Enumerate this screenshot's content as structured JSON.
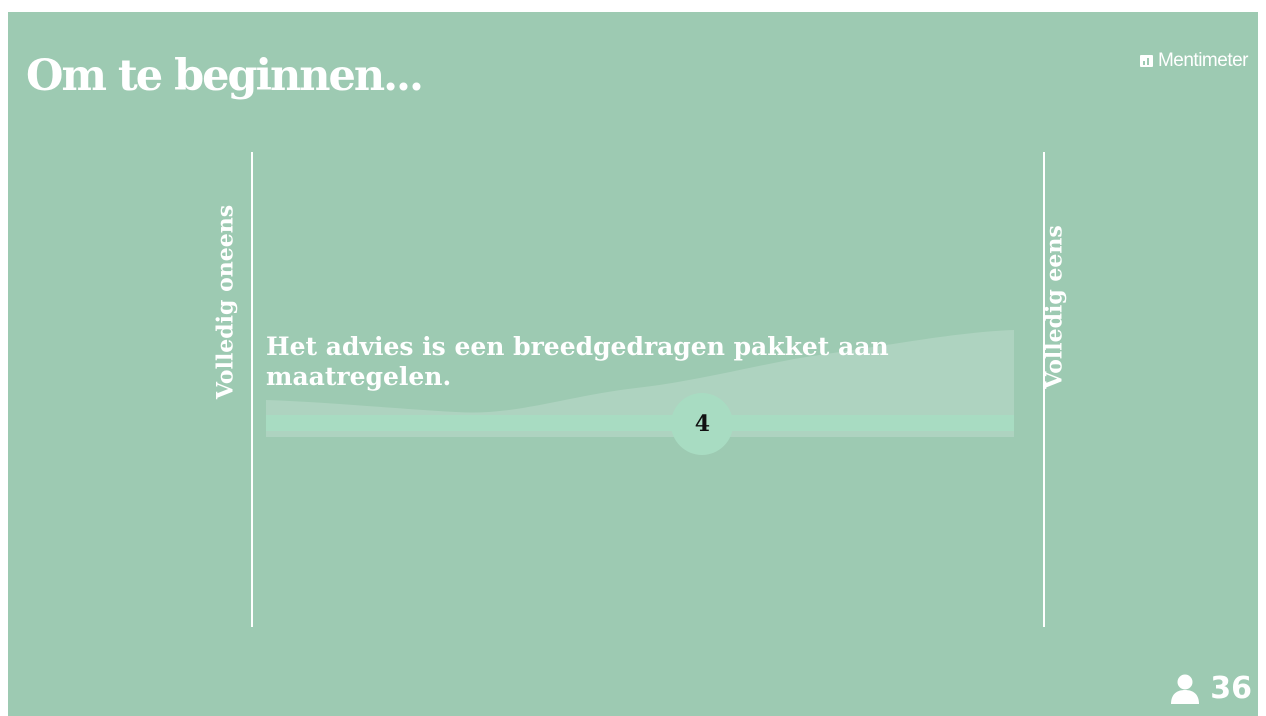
{
  "slide": {
    "title": "Om te beginnen...",
    "brand": "Mentimeter",
    "brand_icon": "mentimeter-bar-chart-icon",
    "background_color": "#9dcab2",
    "accent_color": "#a8dcc2"
  },
  "scale": {
    "left_label": "Volledig oneens",
    "right_label": "Volledig eens",
    "min": 1,
    "max": 5,
    "statement": "Het advies is een breedgedragen pakket aan maatregelen.",
    "average_score": "4",
    "average_value": 4
  },
  "footer": {
    "participant_icon": "person-icon",
    "participant_count": "36"
  }
}
